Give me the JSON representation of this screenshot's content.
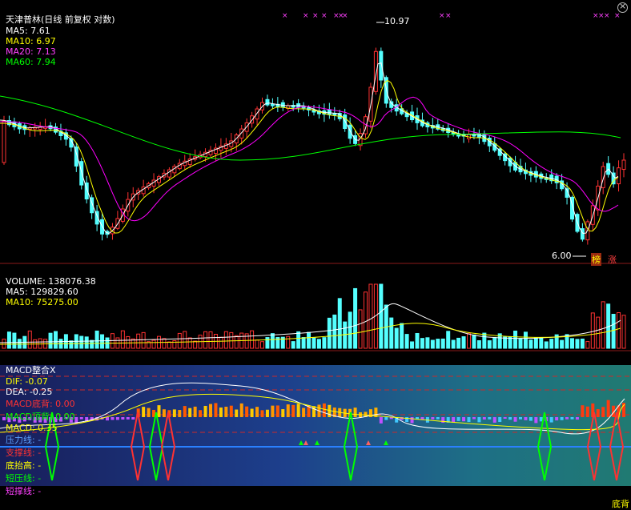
{
  "price_panel": {
    "stock_name": "天津普林",
    "mode": "(日线 前复权 对数)",
    "ma5_label": "MA5: 7.61",
    "ma10_label": "MA10: 6.97",
    "ma20_label": "MA20: 7.13",
    "ma60_label": "MA60: 7.94",
    "high_label": "10.97",
    "low_label": "6.00",
    "badge_bang": "榜",
    "badge_zhang": "涨",
    "colors": {
      "up": "#ff3232",
      "down": "#54ffff",
      "ma5": "#ffffff",
      "ma10": "#ffff00",
      "ma20": "#ff00ff",
      "ma60": "#00ff00",
      "star": "#ff40ff"
    }
  },
  "volume_panel": {
    "vol_label": "VOLUME: 138076.38",
    "ma5_label": "MA5: 129829.60",
    "ma10_label": "MA10: 75275.00"
  },
  "macd_panel": {
    "title": "MACD整合X",
    "dif_label": "DIF: -0.07",
    "dea_label": "DEA: -0.25",
    "bottom_div_label": "MACD底背: 0.00",
    "top_div_label": "MACD顶背: 0.00",
    "macd_label": "MACD: 0.35",
    "pressure_label": "压力线: -",
    "support_label": "支撑线: -",
    "bottom_raise_label": "底抬高: -",
    "short_pressure_label": "短压线: -",
    "short_support_label": "短撑线: -",
    "last_label": "底背"
  },
  "chart_data": {
    "type": "candlestick",
    "title": "天津普林 (日线 前复权 对数)",
    "price_axis": "log",
    "price_range_visible": [
      6.0,
      10.97
    ],
    "indicators": {
      "MA5": 7.61,
      "MA10": 6.97,
      "MA20": 7.13,
      "MA60": 7.94
    },
    "annotations": [
      {
        "text": "10.97",
        "type": "high"
      },
      {
        "text": "6.00",
        "type": "low"
      }
    ],
    "volume": {
      "VOLUME": 138076.38,
      "MA5": 129829.6,
      "MA10": 75275.0
    },
    "macd": {
      "DIF": -0.07,
      "DEA": -0.25,
      "MACD": 0.35,
      "MACD底背": 0.0,
      "MACD顶背": 0.0
    }
  }
}
